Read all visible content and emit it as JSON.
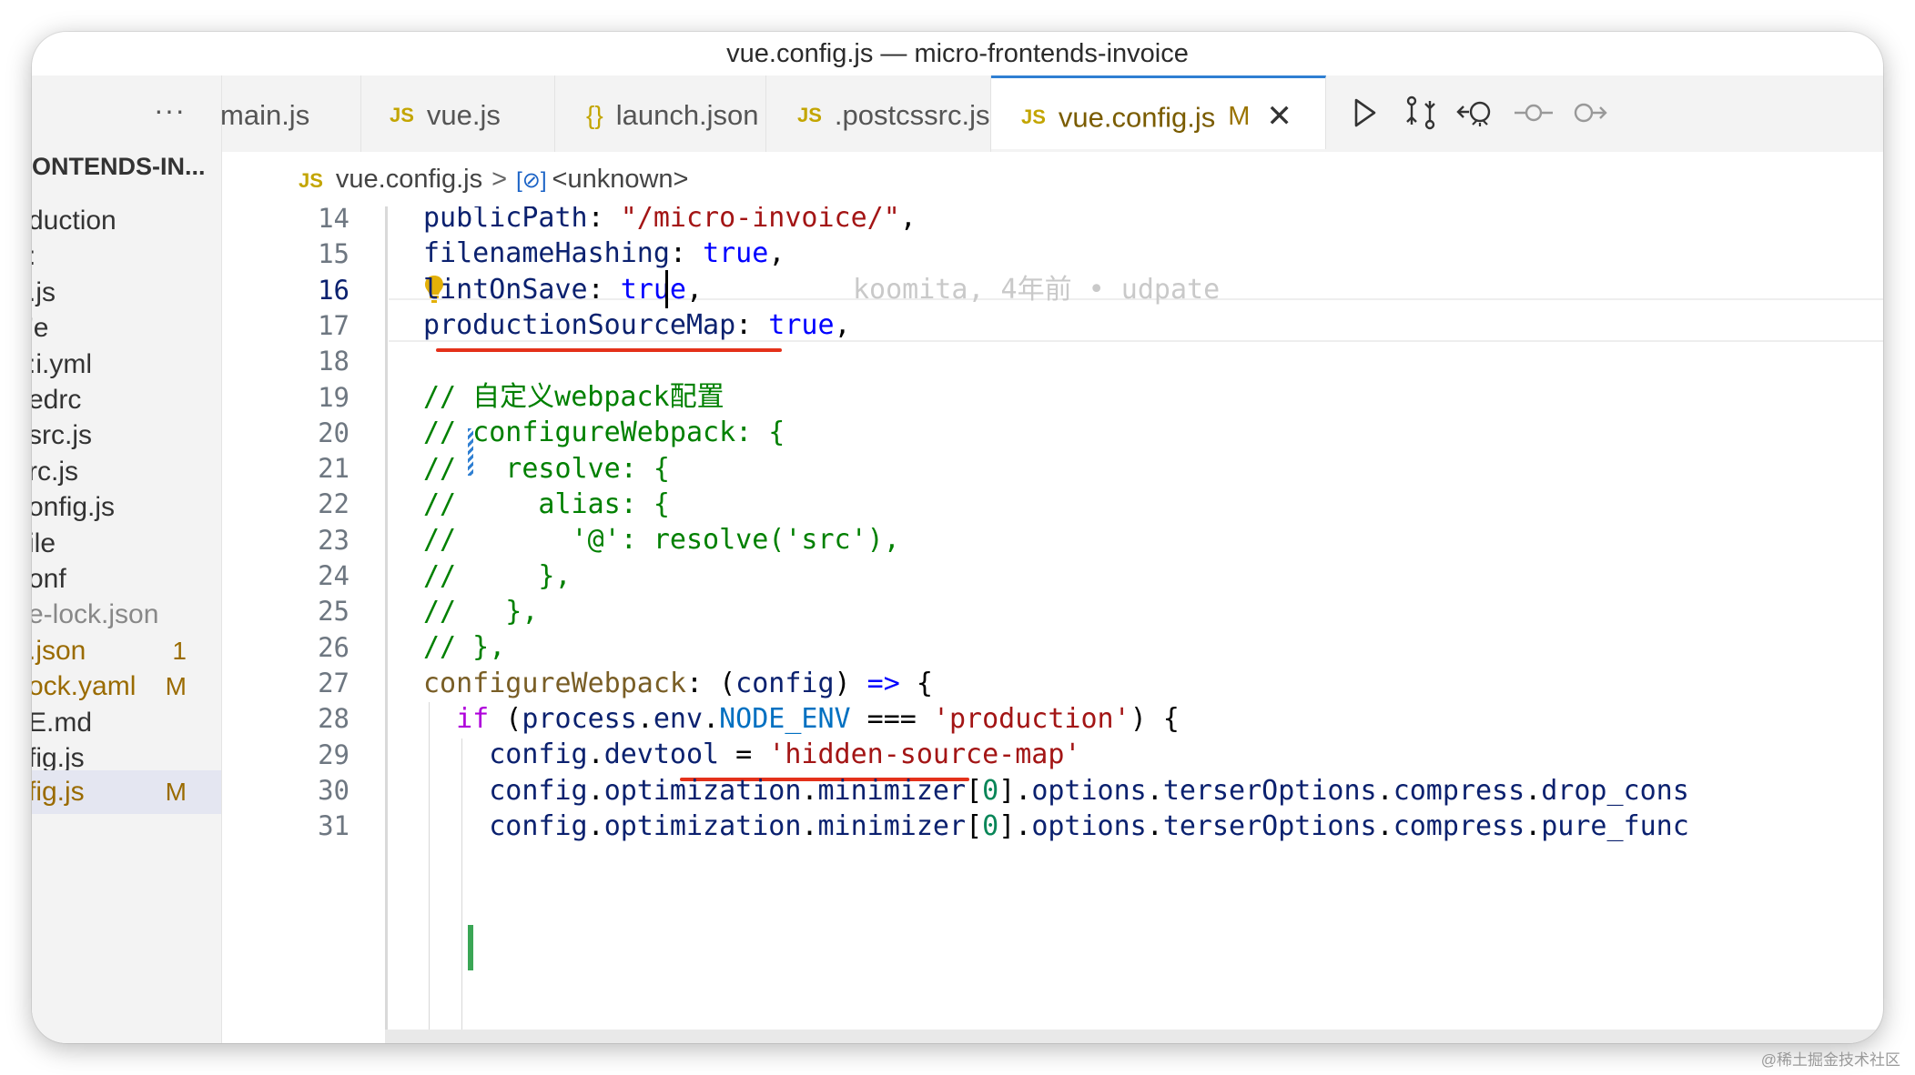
{
  "window": {
    "title": "vue.config.js — micro-frontends-invoice"
  },
  "sidebar": {
    "more_label": "···",
    "header": "ONTENDS-IN...",
    "items": [
      {
        "label": "duction",
        "badge": ""
      },
      {
        "label": ":",
        "badge": ""
      },
      {
        "label": ".js",
        "badge": ""
      },
      {
        "label": "'e",
        "badge": ""
      },
      {
        "label": ":i.yml",
        "badge": ""
      },
      {
        "label": "edrc",
        "badge": ""
      },
      {
        "label": "src.js",
        "badge": ""
      },
      {
        "label": "rc.js",
        "badge": ""
      },
      {
        "label": "onfig.js",
        "badge": ""
      },
      {
        "label": "ile",
        "badge": ""
      },
      {
        "label": "onf",
        "badge": ""
      },
      {
        "label": "e-lock.json",
        "badge": ""
      },
      {
        "label": ".json",
        "badge": "1"
      },
      {
        "label": "ock.yaml",
        "badge": "M"
      },
      {
        "label": "E.md",
        "badge": ""
      },
      {
        "label": "fig.js",
        "badge": ""
      },
      {
        "label": "fig.js",
        "badge": "M"
      }
    ]
  },
  "tabs": [
    {
      "label": "main.js",
      "icon": "",
      "active": false
    },
    {
      "label": "vue.js",
      "icon": "JS",
      "active": false
    },
    {
      "label": "launch.json",
      "icon": "{}",
      "active": false
    },
    {
      "label": ".postcssrc.js",
      "icon": "JS",
      "active": false
    },
    {
      "label": "vue.config.js",
      "icon": "JS",
      "active": true,
      "modified": "M"
    }
  ],
  "breadcrumb": {
    "file_icon": "JS",
    "file": "vue.config.js",
    "separator": ">",
    "symbol": "<unknown>"
  },
  "editor": {
    "blame": "koomita, 4年前 • udpate",
    "line_numbers": [
      "14",
      "15",
      "16",
      "17",
      "18",
      "19",
      "20",
      "21",
      "22",
      "23",
      "24",
      "25",
      "26",
      "27",
      "28",
      "29",
      "30",
      "31"
    ],
    "lines": [
      "publicPath: \"/micro-invoice/\",",
      "filenameHashing: true,",
      "lintOnSave: true,",
      "productionSourceMap: true,",
      "",
      "// 自定义webpack配置",
      "// configureWebpack: {",
      "//   resolve: {",
      "//     alias: {",
      "//       '@': resolve('src'),",
      "//     },",
      "//   },",
      "// },",
      "configureWebpack: (config) => {",
      "  if (process.env.NODE_ENV === 'production') {",
      "    config.devtool = 'hidden-source-map'",
      "    config.optimization.minimizer[0].options.terserOptions.compress.drop_cons",
      "    config.optimization.minimizer[0].options.terserOptions.compress.pure_func"
    ]
  },
  "watermark": "@稀土掘金技术社区"
}
